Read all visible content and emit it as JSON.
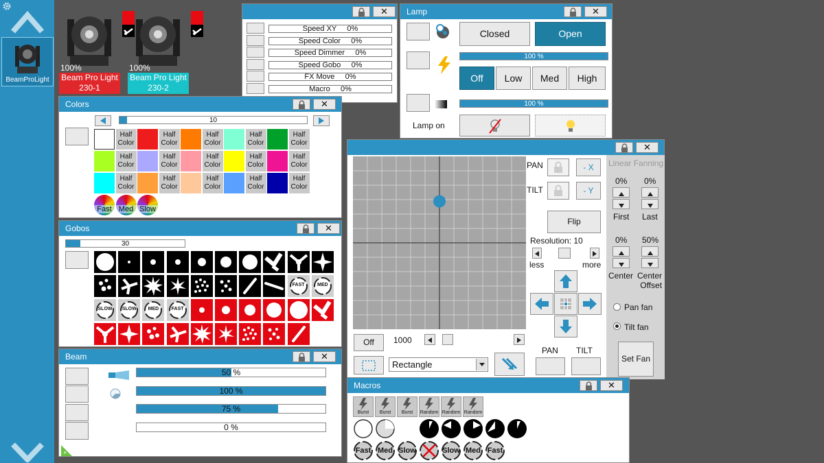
{
  "sidebar": {
    "fixture_label": "BeamProLight"
  },
  "fixtures": [
    {
      "percent": "100%",
      "name": "Beam Pro Light",
      "address": "230-1",
      "color": "#e0282c"
    },
    {
      "percent": "100%",
      "name": "Beam Pro Light",
      "address": "230-2",
      "color": "#19c3c9"
    }
  ],
  "speed": {
    "rows": [
      "Speed XY     0%",
      "Speed Color     0%",
      "Speed Dimmer     0%",
      "Speed Gobo     0%",
      "FX Move     0%",
      "Macro     0%"
    ]
  },
  "lamp": {
    "title": "Lamp",
    "closed": "Closed",
    "open": "Open",
    "bar1": "100 %",
    "off": "Off",
    "low": "Low",
    "med": "Med",
    "high": "High",
    "bar2": "100 %",
    "lamp_on": "Lamp on"
  },
  "colors": {
    "title": "Colors",
    "slider": "10",
    "half_label": "Half\nColor",
    "speeds": [
      "Fast",
      "Med",
      "Slow"
    ],
    "swatches": [
      "#ffffff",
      "H",
      "#ee1c1c",
      "H",
      "#ff7a00",
      "H",
      "#80ffd5",
      "H",
      "#00a12b",
      "H",
      "#aaff22",
      "H",
      "#aaa8ff",
      "H",
      "#ff9aa5",
      "H",
      "#ffff00",
      "H",
      "#ee1493",
      "H",
      "#00ffff",
      "H",
      "#ff9f3c",
      "H",
      "#ffc89a",
      "H",
      "#5aa0ff",
      "H",
      "#0000aa",
      "H"
    ]
  },
  "gobos": {
    "title": "Gobos",
    "slider": "30",
    "tags": [
      "FAST",
      "MED",
      "SLOW",
      "SLOW",
      "MED",
      "FAST"
    ]
  },
  "beam": {
    "title": "Beam",
    "bars": [
      {
        "text": "50 %",
        "value": 0.5
      },
      {
        "text": "100 %",
        "value": 1.0
      },
      {
        "text": "75 %",
        "value": 0.75
      },
      {
        "text": "0 %",
        "value": 0.0
      }
    ]
  },
  "position": {
    "pan": "PAN",
    "tilt": "TILT",
    "neg_x": "- X",
    "neg_y": "- Y",
    "flip": "Flip",
    "resolution": "Resolution: 10",
    "less": "less",
    "more": "more",
    "off": "Off",
    "speed_value": "1000",
    "shape": "Rectangle",
    "pan_bottom": "PAN",
    "tilt_bottom": "TILT",
    "dot_x": 0.5,
    "dot_y": 0.26
  },
  "fanning": {
    "title": "Linear Fanning",
    "first_pct": "0%",
    "last_pct": "0%",
    "first": "First",
    "last": "Last",
    "center_pct": "0%",
    "offset_pct": "50%",
    "center": "Center",
    "center_offset": "Center\nOffset",
    "pan_fan": "Pan fan",
    "tilt_fan": "Tilt fan",
    "set_fan": "Set Fan"
  },
  "macros": {
    "title": "Macros",
    "row1": [
      "Burst",
      "Burst",
      "Burst",
      "Random",
      "Random",
      "Random"
    ],
    "row3": [
      "Fast",
      "Med",
      "Slow",
      "",
      "Slow",
      "Med",
      "Fast"
    ]
  },
  "colors_theme": {
    "accent": "#2b8fc0",
    "red": "#e30712"
  }
}
